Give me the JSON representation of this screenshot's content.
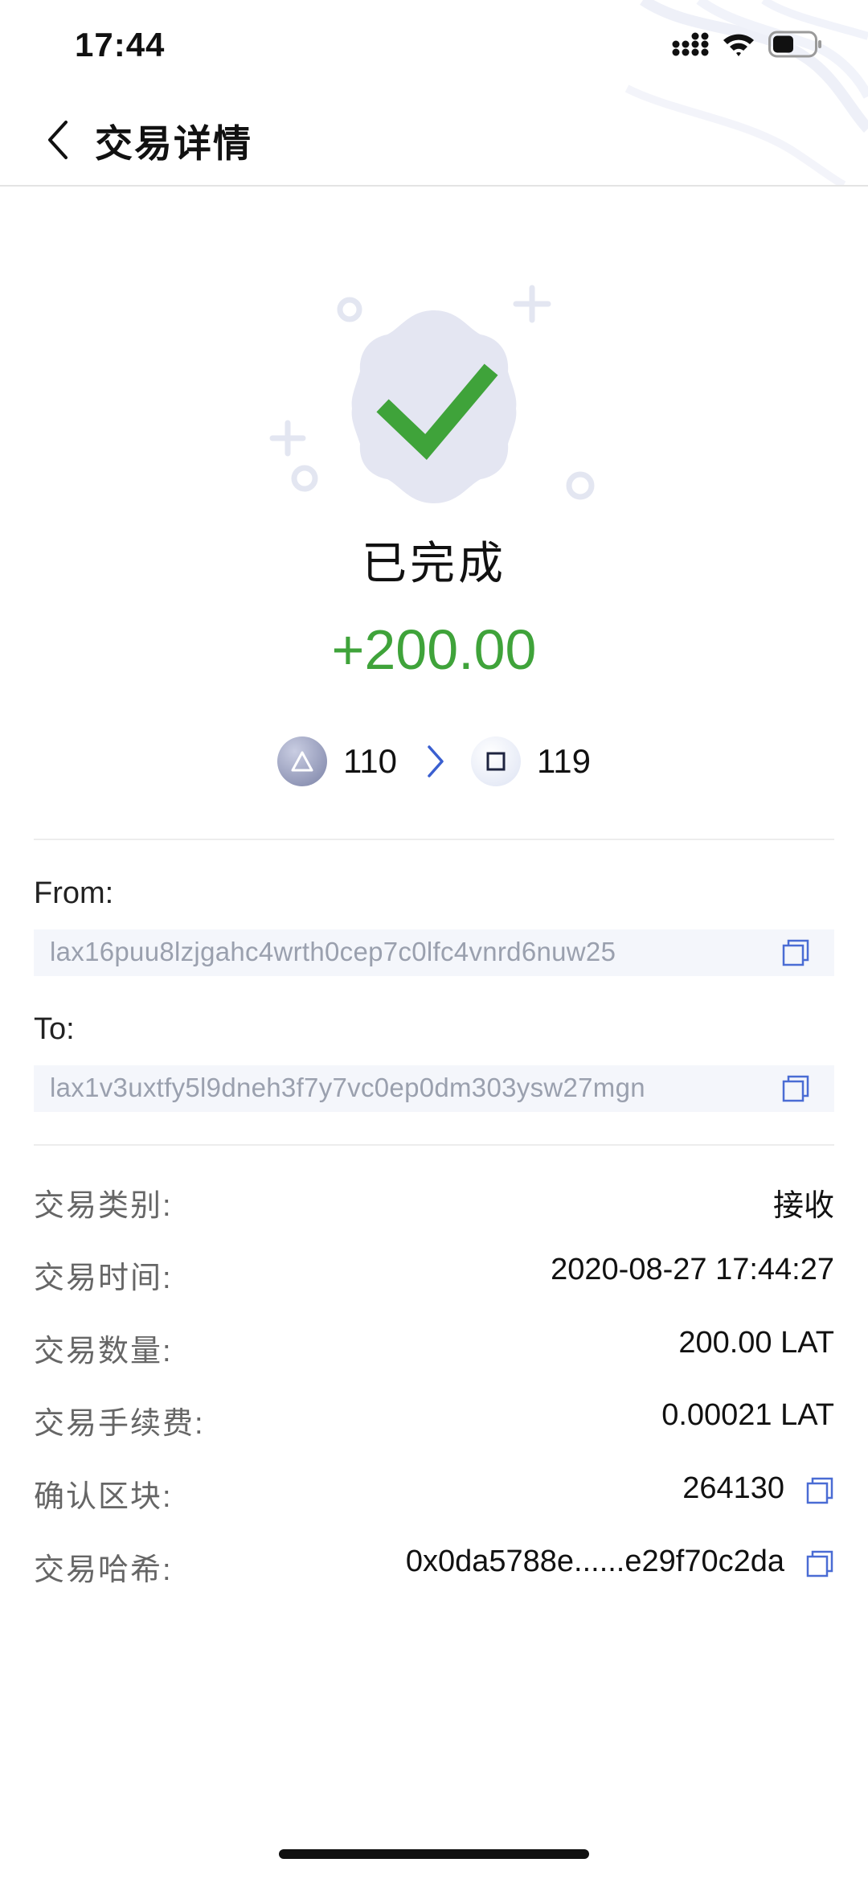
{
  "status_bar": {
    "time": "17:44",
    "battery_level": 0.5
  },
  "header": {
    "title": "交易详情",
    "back_icon": "chevron-left-icon"
  },
  "hero": {
    "status": "已完成",
    "amount": "+200.00",
    "amount_color": "#3fa33a",
    "badge_icon": "check-badge-icon"
  },
  "blocks": {
    "from_block": "110",
    "to_block": "119"
  },
  "from": {
    "label": "From:",
    "address": "lax16puu8lzjgahc4wrth0cep7c0lfc4vnrd6nuw25"
  },
  "to": {
    "label": "To:",
    "address": "lax1v3uxtfy5l9dneh3f7y7vc0ep0dm303ysw27mgn"
  },
  "details": {
    "type": {
      "label": "交易类别:",
      "value": "接收"
    },
    "time": {
      "label": "交易时间:",
      "value": "2020-08-27 17:44:27"
    },
    "amount": {
      "label": "交易数量:",
      "value": "200.00 LAT"
    },
    "fee": {
      "label": "交易手续费:",
      "value": "0.00021 LAT"
    },
    "block": {
      "label": "确认区块:",
      "value": "264130"
    },
    "hash": {
      "label": "交易哈希:",
      "value": "0x0da5788e......e29f70c2da"
    }
  },
  "colors": {
    "accent": "#3fa33a",
    "link_blue": "#3a5fd0",
    "copy_icon": "#4a6cd4"
  }
}
